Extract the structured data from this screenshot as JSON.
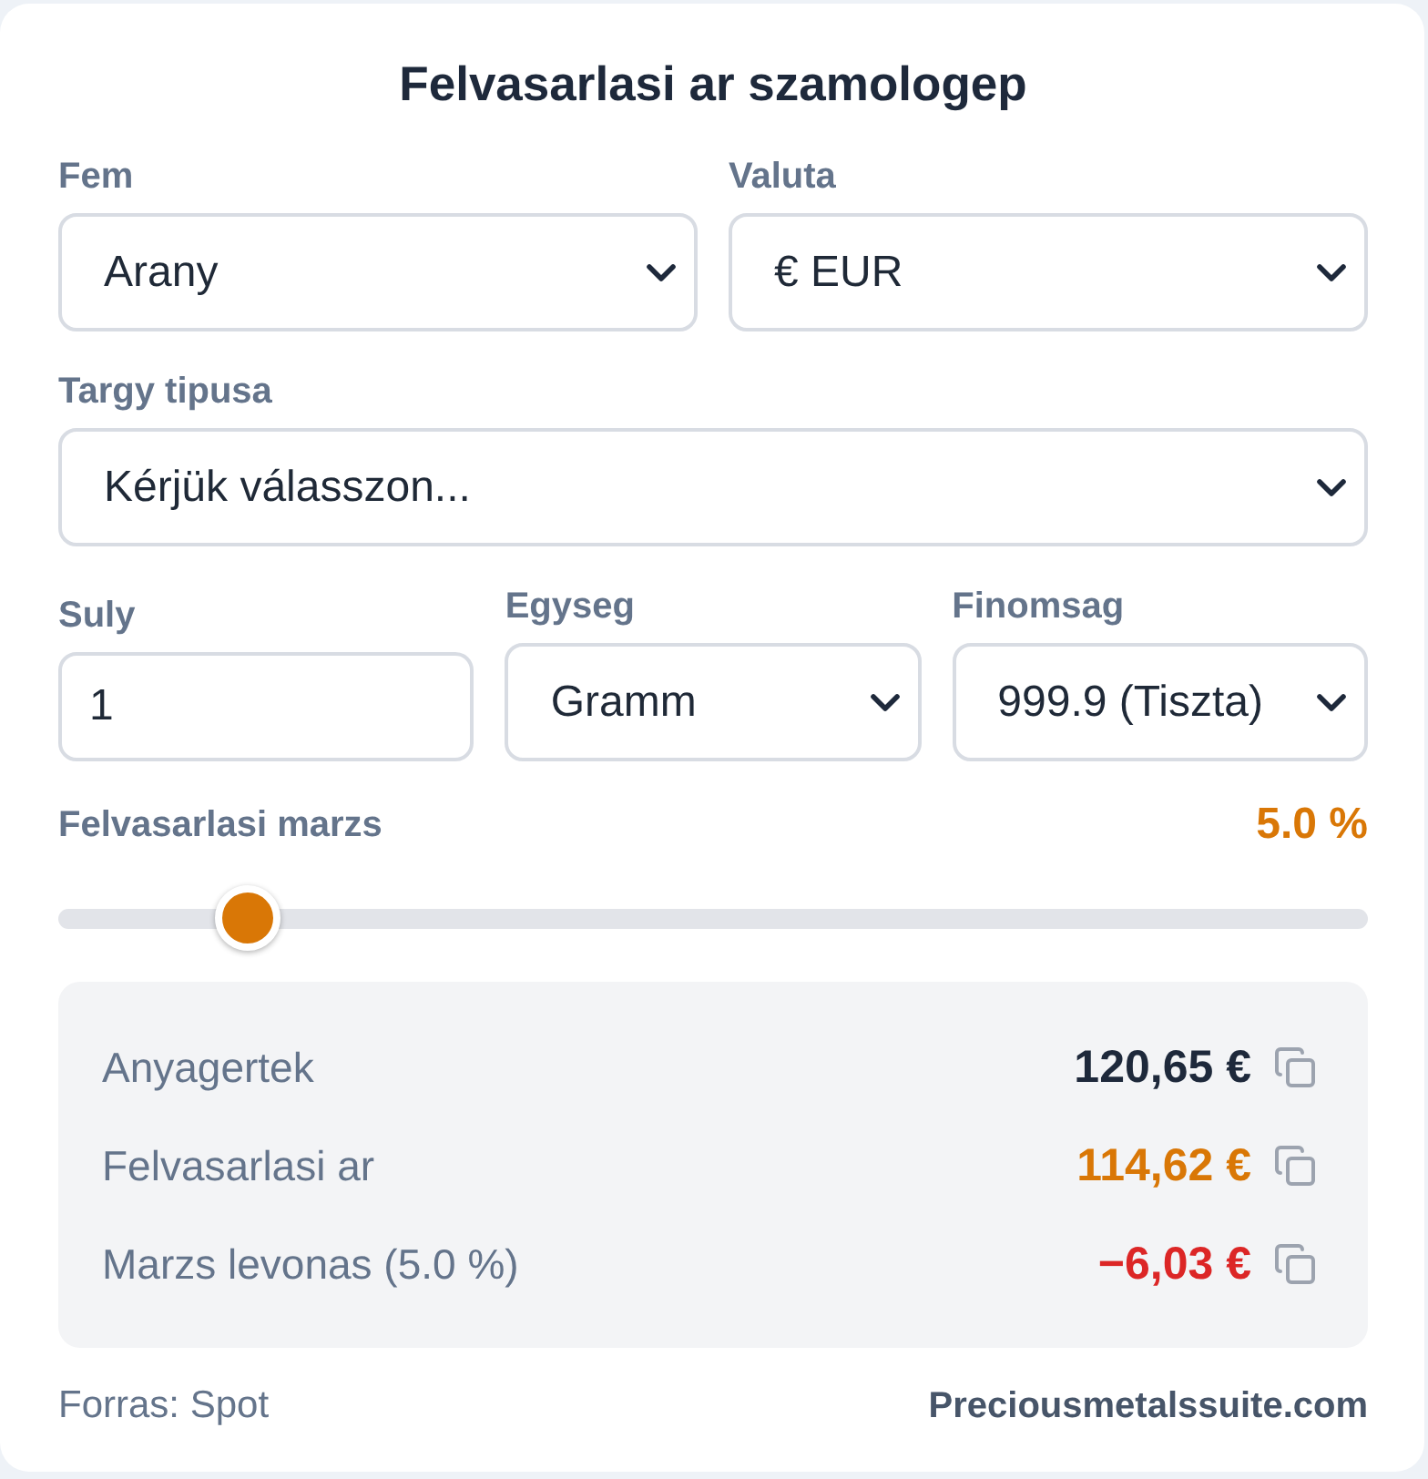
{
  "title": "Felvasarlasi ar szamologep",
  "form_rows": [
    {
      "fields": [
        {
          "kind": "select",
          "label": "Fem",
          "value": "Arany"
        },
        {
          "kind": "select",
          "label": "Valuta",
          "value": "€ EUR"
        }
      ]
    },
    {
      "fields": [
        {
          "kind": "select",
          "label": "Targy tipusa",
          "value": "Kérjük válasszon..."
        }
      ]
    },
    {
      "fields": [
        {
          "kind": "input",
          "label": "Suly",
          "value": "1"
        },
        {
          "kind": "select",
          "label": "Egyseg",
          "value": "Gramm"
        },
        {
          "kind": "select",
          "label": "Finomsag",
          "value": "999.9 (Tiszta)"
        }
      ]
    }
  ],
  "margin": {
    "label": "Felvasarlasi marzs",
    "reading": "5.0 %",
    "level": 0.126
  },
  "results": [
    {
      "label": "Anyagertek",
      "value": "120,65 €",
      "color": "#1e293b"
    },
    {
      "label": "Felvasarlasi ar",
      "value": "114,62 €",
      "color": "#d97706"
    },
    {
      "label": "Marzs levonas (5.0 %)",
      "value": "−6,03 €",
      "color": "#dc2626"
    }
  ],
  "footer": {
    "source": "Forras: Spot",
    "brand": "Preciousmetalssuite.com"
  }
}
